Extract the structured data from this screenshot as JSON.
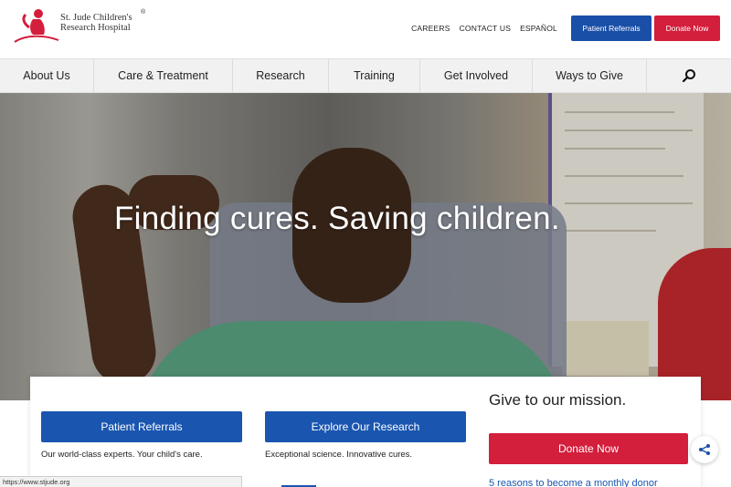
{
  "header": {
    "logo_line1": "St. Jude Children's",
    "logo_line2": "Research Hospital",
    "logo_reg": "®",
    "util_links": [
      "CAREERS",
      "CONTACT US",
      "ESPAÑOL"
    ],
    "patient_referrals_label": "Patient Referrals",
    "donate_label": "Donate Now"
  },
  "nav": {
    "items": [
      "About Us",
      "Care & Treatment",
      "Research",
      "Training",
      "Get Involved",
      "Ways to Give"
    ],
    "search_icon": "search-icon"
  },
  "hero": {
    "title": "Finding cures. Saving children."
  },
  "cards": {
    "patient_referrals_label": "Patient Referrals",
    "patient_referrals_caption": "Our world-class experts. Your child's care.",
    "explore_research_label": "Explore Our Research",
    "explore_research_caption": "Exceptional science. Innovative cures.",
    "give_title": "Give to our mission.",
    "donate_label": "Donate Now",
    "monthly_link": "5 reasons to become a monthly donor"
  },
  "share_icon": "share-icon",
  "status_bar": "https://www.stjude.org",
  "colors": {
    "brand_red": "#d31e3c",
    "brand_blue": "#1a4fa8",
    "nav_bg": "#f1f1f1"
  }
}
